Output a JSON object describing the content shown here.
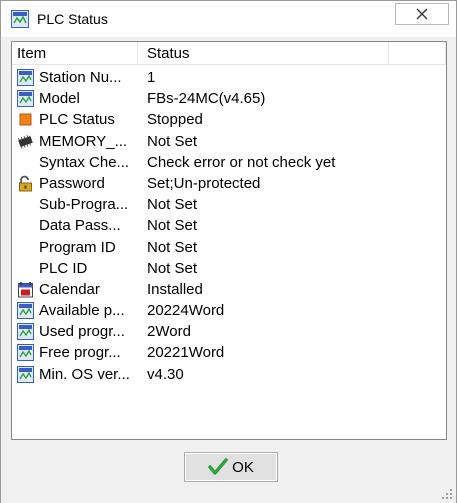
{
  "window": {
    "title": "PLC Status",
    "close_label": "Close"
  },
  "list": {
    "columns": [
      "Item",
      "Status"
    ],
    "rows": [
      {
        "icon": "app-icon",
        "name": "Station Nu...",
        "value": "1"
      },
      {
        "icon": "app-icon",
        "name": "Model",
        "value": "FBs-24MC(v4.65)"
      },
      {
        "icon": "stop-square-icon",
        "name": "PLC Status",
        "value": "Stopped"
      },
      {
        "icon": "memory-chip-icon",
        "name": "MEMORY_...",
        "value": "Not Set"
      },
      {
        "icon": "",
        "name": "Syntax Che...",
        "value": "Check error or not check yet"
      },
      {
        "icon": "padlock-open-icon",
        "name": "Password",
        "value": "Set;Un-protected"
      },
      {
        "icon": "",
        "name": "Sub-Progra...",
        "value": "Not Set"
      },
      {
        "icon": "",
        "name": "Data Pass...",
        "value": "Not Set"
      },
      {
        "icon": "",
        "name": "Program ID",
        "value": "Not Set"
      },
      {
        "icon": "",
        "name": "PLC ID",
        "value": "Not Set"
      },
      {
        "icon": "calendar-icon",
        "name": "Calendar",
        "value": "Installed"
      },
      {
        "icon": "app-icon",
        "name": "Available p...",
        "value": "20224Word"
      },
      {
        "icon": "app-icon",
        "name": "Used progr...",
        "value": "2Word"
      },
      {
        "icon": "app-icon",
        "name": "Free progr...",
        "value": "20221Word"
      },
      {
        "icon": "app-icon",
        "name": "Min. OS ver...",
        "value": "v4.30"
      }
    ]
  },
  "footer": {
    "ok_label": "OK"
  },
  "colors": {
    "stop": "#f0801a",
    "check": "#2ea43a",
    "calendar_red": "#cc2020",
    "app_blue": "#3b5fc0"
  }
}
